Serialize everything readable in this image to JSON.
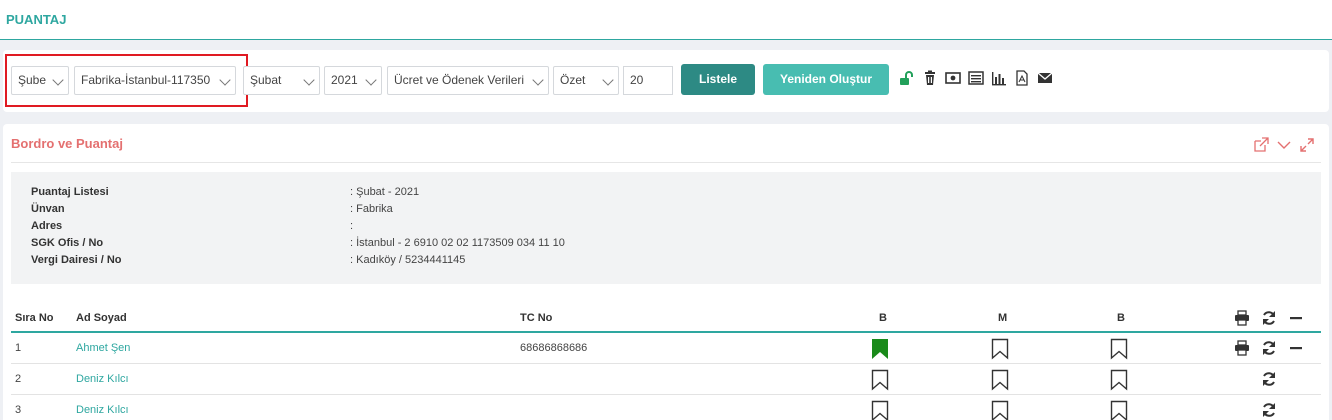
{
  "header": {
    "title": "PUANTAJ"
  },
  "filters": {
    "sube": "Şube",
    "location": "Fabrika-İstanbul-117350",
    "month": "Şubat",
    "year": "2021",
    "report": "Ücret ve Ödenek Verileri",
    "mode": "Özet",
    "count": "20",
    "listele_label": "Listele",
    "yeniden_label": "Yeniden Oluştur"
  },
  "colors": {
    "accent": "#2ea7a0",
    "title_red": "#e47070",
    "bookmark_active": "#1a8a1a",
    "highlight": "#e01a22"
  },
  "panel": {
    "title": "Bordro ve Puantaj",
    "info": [
      {
        "label": "Puantaj Listesi",
        "value": ": Şubat - 2021"
      },
      {
        "label": "Ünvan",
        "value": ": Fabrika"
      },
      {
        "label": "Adres",
        "value": ":"
      },
      {
        "label": "SGK Ofis / No",
        "value": ": İstanbul - 2 6910 02 02 1173509 034 11 10"
      },
      {
        "label": "Vergi Dairesi / No",
        "value": ": Kadıköy / 5234441145"
      }
    ]
  },
  "table": {
    "headers": {
      "sira": "Sıra No",
      "ad": "Ad Soyad",
      "tc": "TC No",
      "b1": "B",
      "m": "M",
      "b2": "B"
    },
    "rows": [
      {
        "sira": "1",
        "ad": "Ahmet Şen",
        "tc": "68686868686",
        "b1_active": true
      },
      {
        "sira": "2",
        "ad": "Deniz Kılcı",
        "tc": "",
        "b1_active": false
      },
      {
        "sira": "3",
        "ad": "Deniz Kılcı",
        "tc": "",
        "b1_active": false
      }
    ]
  }
}
